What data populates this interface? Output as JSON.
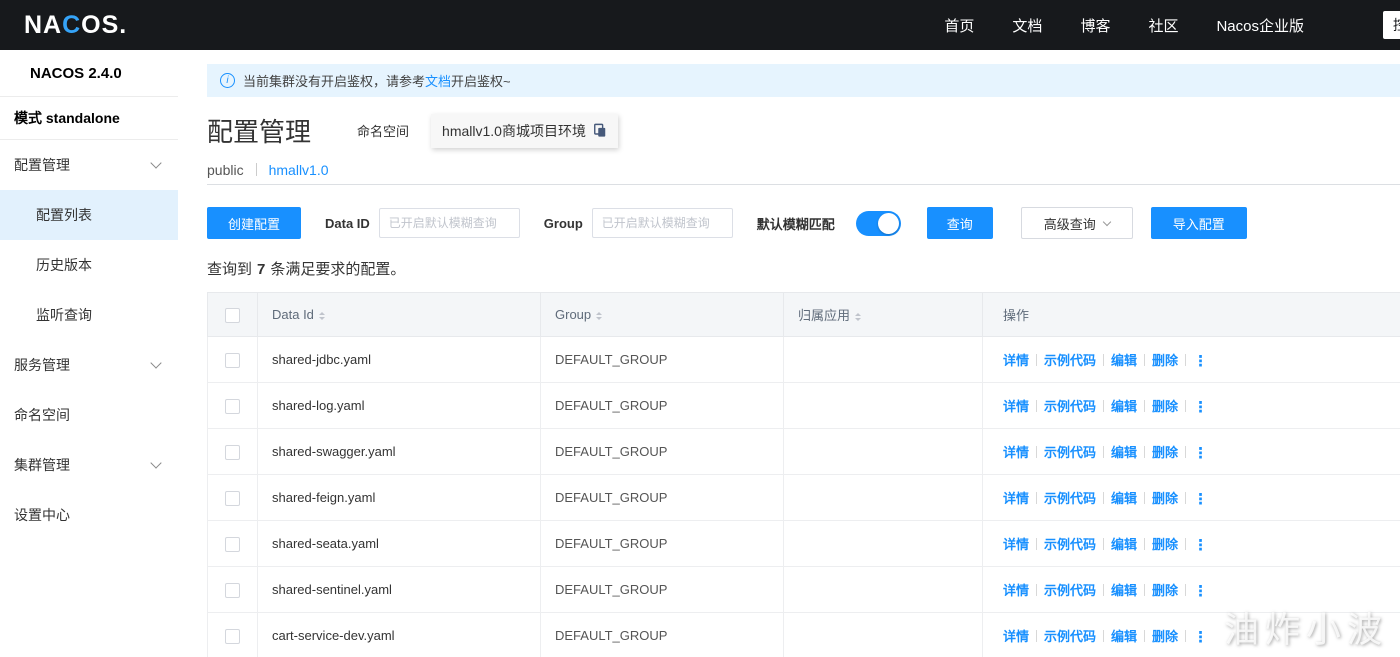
{
  "topbar": {
    "logo_part1": "NA",
    "logo_c": "C",
    "logo_part2": "OS.",
    "nav": [
      "首页",
      "文档",
      "博客",
      "社区",
      "Nacos企业版"
    ],
    "console_button": "控制台"
  },
  "sidebar": {
    "version": "NACOS 2.4.0",
    "mode_label": "模式",
    "mode_value": "standalone",
    "items": [
      {
        "label": "配置管理"
      },
      {
        "label": "配置列表"
      },
      {
        "label": "历史版本"
      },
      {
        "label": "监听查询"
      },
      {
        "label": "服务管理"
      },
      {
        "label": "命名空间"
      },
      {
        "label": "集群管理"
      },
      {
        "label": "设置中心"
      }
    ]
  },
  "banner": {
    "text_before": "当前集群没有开启鉴权，请参考",
    "link_label": "文档",
    "text_after": "开启鉴权~"
  },
  "page": {
    "title": "配置管理",
    "namespace_label": "命名空间",
    "namespace_value": "hmallv1.0商城项目环境"
  },
  "namespace_tabs": {
    "items": [
      "public",
      "hmallv1.0"
    ],
    "active": "hmallv1.0"
  },
  "toolbar": {
    "create_button": "创建配置",
    "data_id_label": "Data ID",
    "data_id_placeholder": "已开启默认模糊查询",
    "data_id_value": "",
    "group_label": "Group",
    "group_placeholder": "已开启默认模糊查询",
    "group_value": "",
    "fuzzy_label": "默认模糊匹配",
    "fuzzy_on": true,
    "query_button": "查询",
    "advanced_button": "高级查询",
    "import_button": "导入配置"
  },
  "result": {
    "prefix": "查询到",
    "count": "7",
    "suffix": "条满足要求的配置。"
  },
  "table": {
    "headers": {
      "data_id": "Data Id",
      "group": "Group",
      "app": "归属应用",
      "actions": "操作"
    },
    "action_labels": [
      "详情",
      "示例代码",
      "编辑",
      "删除"
    ],
    "rows": [
      {
        "data_id": "shared-jdbc.yaml",
        "group": "DEFAULT_GROUP",
        "app": ""
      },
      {
        "data_id": "shared-log.yaml",
        "group": "DEFAULT_GROUP",
        "app": ""
      },
      {
        "data_id": "shared-swagger.yaml",
        "group": "DEFAULT_GROUP",
        "app": ""
      },
      {
        "data_id": "shared-feign.yaml",
        "group": "DEFAULT_GROUP",
        "app": ""
      },
      {
        "data_id": "shared-seata.yaml",
        "group": "DEFAULT_GROUP",
        "app": ""
      },
      {
        "data_id": "shared-sentinel.yaml",
        "group": "DEFAULT_GROUP",
        "app": ""
      },
      {
        "data_id": "cart-service-dev.yaml",
        "group": "DEFAULT_GROUP",
        "app": ""
      }
    ]
  },
  "watermark": "油炸小波",
  "colors": {
    "accent_blue": "#1890ff",
    "topbar_bg": "#17191c",
    "banner_bg": "#e6f4fe",
    "active_item_bg": "#e2f1fd",
    "table_header_bg": "#f4f6f8"
  }
}
